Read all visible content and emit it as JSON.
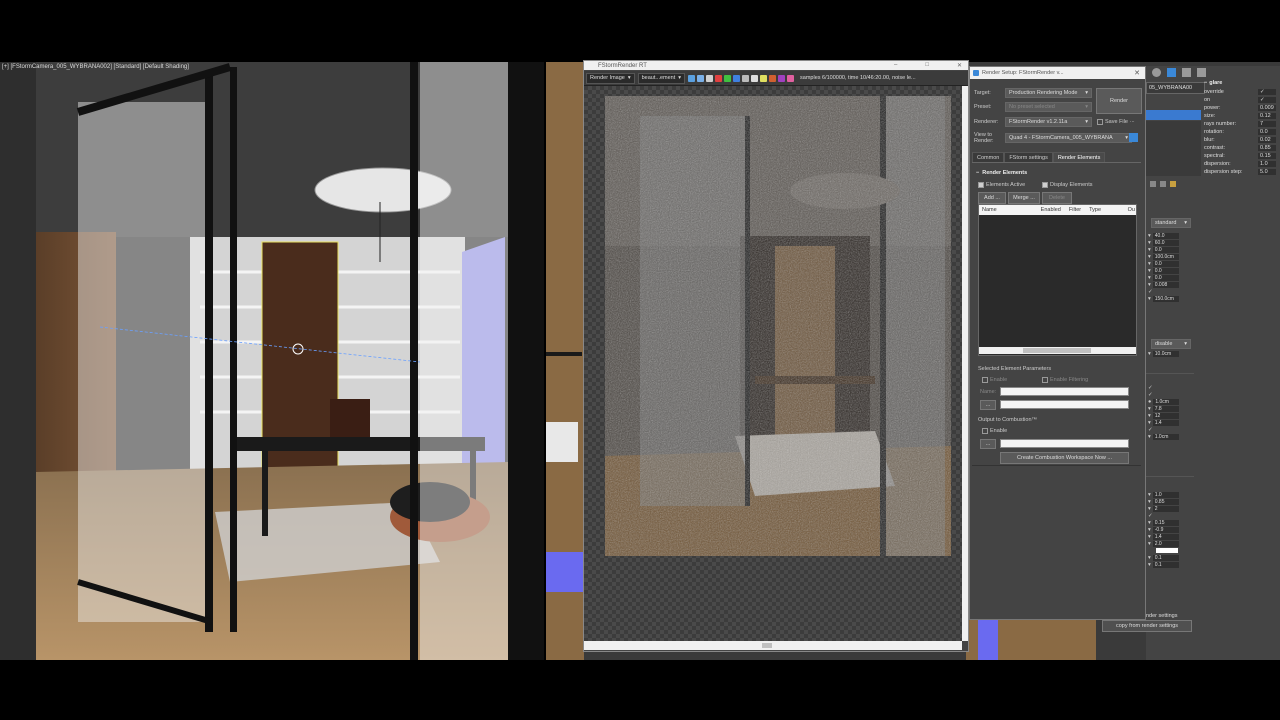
{
  "viewport": {
    "label": "[+] [FStormCamera_005_WYBRANA002] [Standard] [Default Shading]"
  },
  "frame_buffer": {
    "title": "FStormRender RT",
    "mode": "Render Image",
    "element": "beaut...ement",
    "status": "samples 6/100000,  time 10/46:20.00,  noise le..."
  },
  "render_setup": {
    "title": "Render Setup: FStormRender v...",
    "target_label": "Target:",
    "target_value": "Production Rendering Mode",
    "preset_label": "Preset:",
    "preset_value": "No preset selected",
    "renderer_label": "Renderer:",
    "renderer_value": "FStormRender v1.2.11a",
    "save_file": "Save File",
    "view_label": "View to Render:",
    "view_value": "Quad 4 - FStormCamera_005_WYBRANA",
    "render_button": "Render",
    "tabs": [
      "Common",
      "FStorm settings",
      "Render Elements"
    ],
    "rollout_title": "Render Elements",
    "elements_active": "Elements Active",
    "display_elements": "Display Elements",
    "add_button": "Add ...",
    "merge_button": "Merge ...",
    "delete_button": "Delete",
    "table_headers": [
      "Name",
      "Enabled",
      "Filter",
      "Type",
      "Ou"
    ],
    "selected_params": "Selected Element Parameters",
    "enable": "Enable",
    "enable_filtering": "Enable Filtering",
    "name_label": "Name:",
    "browse_btn": "...",
    "output_combustion": "Output to Combustion™",
    "enable2": "Enable",
    "browse_btn2": "...",
    "create_combustion": "Create Combustion Workspace Now ..."
  },
  "command_panel": {
    "object_name": "05_WYBRANA00",
    "preset": "standard",
    "values_a": [
      "40.0",
      "60.0",
      "0.0",
      "100.0cm",
      "0.0",
      "0.0",
      "0.0",
      "0.008",
      "",
      "150.0cm"
    ],
    "dropdown": "disable",
    "value_b": "10.0cm",
    "values_c": [
      "1.0cm",
      "7.8",
      "12",
      "1.4",
      "",
      "1.0cm"
    ],
    "values_d": [
      "1.0",
      "0.85",
      "2",
      "0.15",
      "-0.9",
      "1.4",
      "2.0",
      "",
      "0.1",
      "0.1"
    ],
    "button_label": "copy from render settings",
    "button_label_cut": "nder settings"
  },
  "glare": {
    "title": "glare",
    "params": [
      {
        "name": "override",
        "value": "✓"
      },
      {
        "name": "on",
        "value": "✓"
      },
      {
        "name": "power:",
        "value": "0.009"
      },
      {
        "name": "size:",
        "value": "0.12"
      },
      {
        "name": "rays number:",
        "value": "7"
      },
      {
        "name": "rotation:",
        "value": "0.0"
      },
      {
        "name": "blur:",
        "value": "0.02"
      },
      {
        "name": "contrast:",
        "value": "0.85"
      },
      {
        "name": "spectral:",
        "value": "0.15"
      },
      {
        "name": "dispersion:",
        "value": "1.0"
      },
      {
        "name": "dispersion step:",
        "value": "5.0"
      }
    ]
  }
}
